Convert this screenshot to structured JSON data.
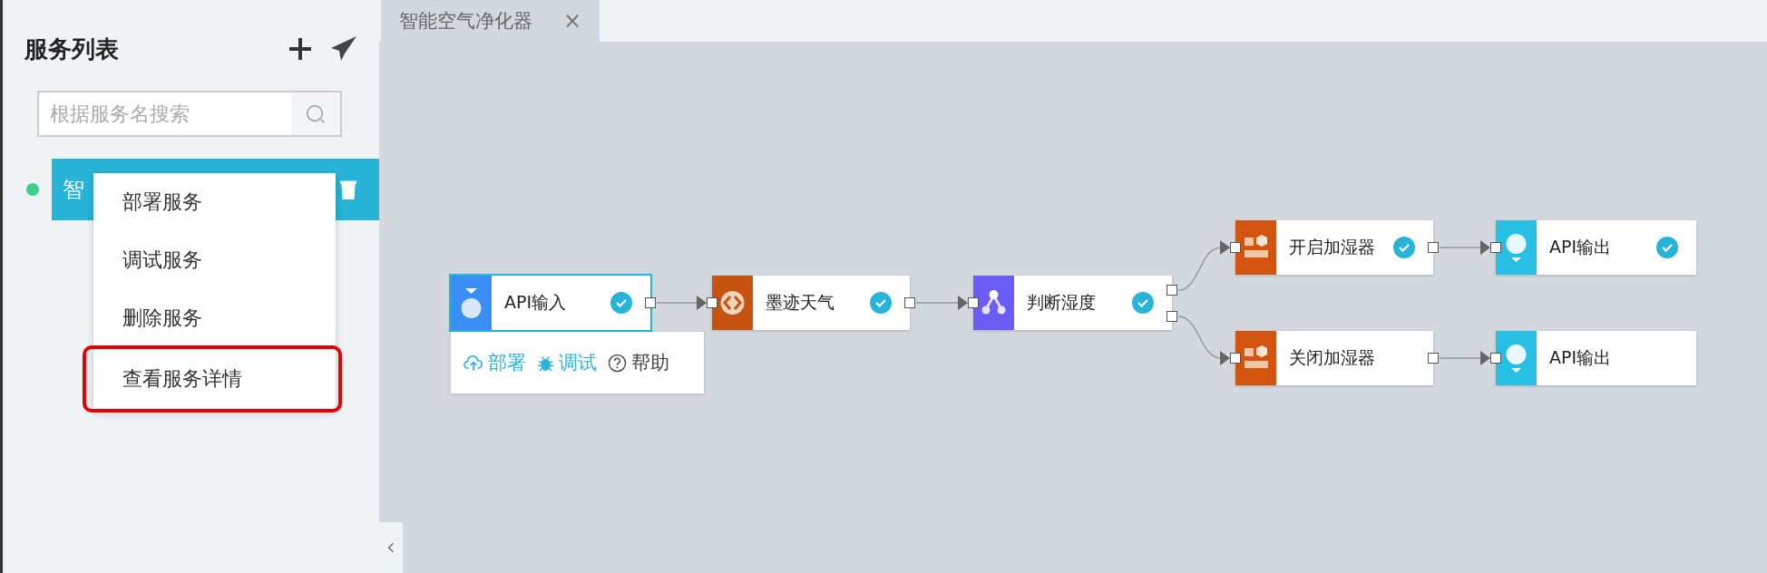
{
  "sidebar": {
    "title": "服务列表",
    "search": {
      "placeholder": "根据服务名搜索"
    },
    "services": [
      {
        "name": "智",
        "online": true,
        "selected": true
      }
    ],
    "context_menu": [
      {
        "label": "部署服务",
        "highlighted": false
      },
      {
        "label": "调试服务",
        "highlighted": false
      },
      {
        "label": "删除服务",
        "highlighted": false
      },
      {
        "label": "查看服务详情",
        "highlighted": true
      }
    ]
  },
  "tabs": [
    {
      "label": "智能空气净化器",
      "selected": true,
      "close": "×"
    }
  ],
  "flow": {
    "nodes": [
      {
        "label": "API输入",
        "kind": "input",
        "color": "#3a8ef6",
        "done": true,
        "selected": true
      },
      {
        "label": "墨迹天气",
        "kind": "code",
        "color": "#c4540f",
        "done": true,
        "selected": false
      },
      {
        "label": "判断湿度",
        "kind": "branch",
        "color": "#6c5cf6",
        "done": true,
        "selected": false
      },
      {
        "label": "开启加湿器",
        "kind": "action",
        "color": "#d2540e",
        "done": true,
        "selected": false
      },
      {
        "label": "API输出",
        "kind": "output",
        "color": "#27bfe3",
        "done": true,
        "selected": false
      },
      {
        "label": "关闭加湿器",
        "kind": "action",
        "color": "#d2540e",
        "done": false,
        "selected": false
      },
      {
        "label": "API输出",
        "kind": "output",
        "color": "#27bfe3",
        "done": false,
        "selected": false
      }
    ],
    "node_toolbar": [
      {
        "label": "部署",
        "kind": "deploy"
      },
      {
        "label": "调试",
        "kind": "debug"
      },
      {
        "label": "帮助",
        "kind": "help"
      }
    ]
  }
}
